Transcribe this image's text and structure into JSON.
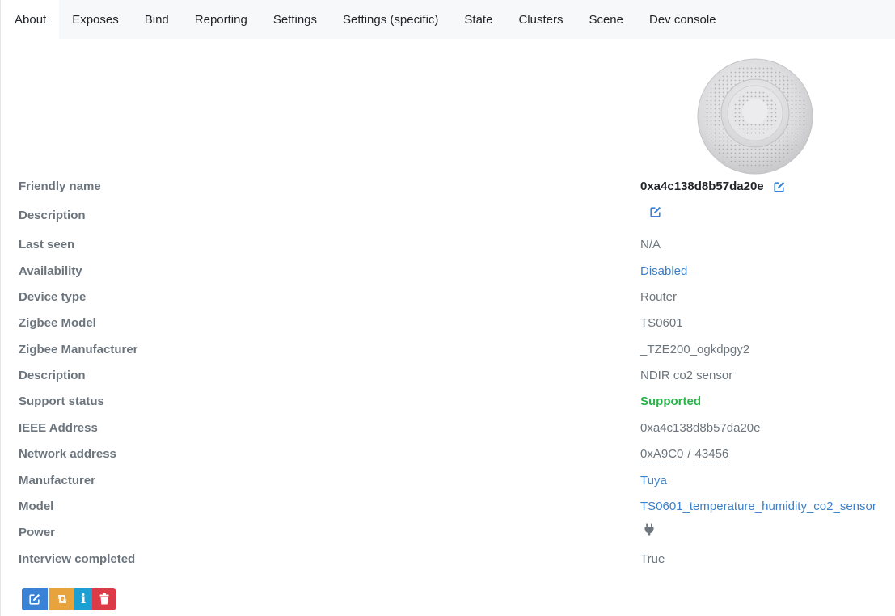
{
  "tabs": [
    {
      "label": "About",
      "active": true
    },
    {
      "label": "Exposes"
    },
    {
      "label": "Bind"
    },
    {
      "label": "Reporting"
    },
    {
      "label": "Settings"
    },
    {
      "label": "Settings (specific)"
    },
    {
      "label": "State"
    },
    {
      "label": "Clusters"
    },
    {
      "label": "Scene"
    },
    {
      "label": "Dev console"
    }
  ],
  "device": {
    "image_icon": "device-sensor-image",
    "friendly_name": {
      "label": "Friendly name",
      "value": "0xa4c138d8b57da20e"
    },
    "description": {
      "label": "Description",
      "value": ""
    },
    "last_seen": {
      "label": "Last seen",
      "value": "N/A"
    },
    "availability": {
      "label": "Availability",
      "value": "Disabled"
    },
    "device_type": {
      "label": "Device type",
      "value": "Router"
    },
    "zigbee_model": {
      "label": "Zigbee Model",
      "value": "TS0601"
    },
    "zigbee_manufacturer": {
      "label": "Zigbee Manufacturer",
      "value": "_TZE200_ogkdpgy2"
    },
    "definition_description": {
      "label": "Description",
      "value": "NDIR co2 sensor"
    },
    "support_status": {
      "label": "Support status",
      "value": "Supported"
    },
    "ieee_address": {
      "label": "IEEE Address",
      "value": "0xa4c138d8b57da20e"
    },
    "network_address": {
      "label": "Network address",
      "hex": "0xA9C0",
      "separator": "/",
      "dec": "43456"
    },
    "manufacturer": {
      "label": "Manufacturer",
      "value": "Tuya"
    },
    "model": {
      "label": "Model",
      "value": "TS0601_temperature_humidity_co2_sensor"
    },
    "power": {
      "label": "Power",
      "icon": "plug-icon"
    },
    "interview_completed": {
      "label": "Interview completed",
      "value": "True"
    }
  },
  "actions": [
    {
      "name": "edit-button",
      "icon": "edit-icon",
      "color": "#3a82d6"
    },
    {
      "name": "reconfigure-button",
      "icon": "retweet-icon",
      "color": "#e8a33c"
    },
    {
      "name": "interview-button",
      "icon": "info-icon",
      "color": "#1e9fd3"
    },
    {
      "name": "delete-button",
      "icon": "trash-icon",
      "color": "#dc3a46"
    }
  ],
  "colors": {
    "link": "#3d7fc7",
    "success": "#2bb34a",
    "muted": "#6c757d",
    "tabbar_bg": "#f7f8fa"
  }
}
